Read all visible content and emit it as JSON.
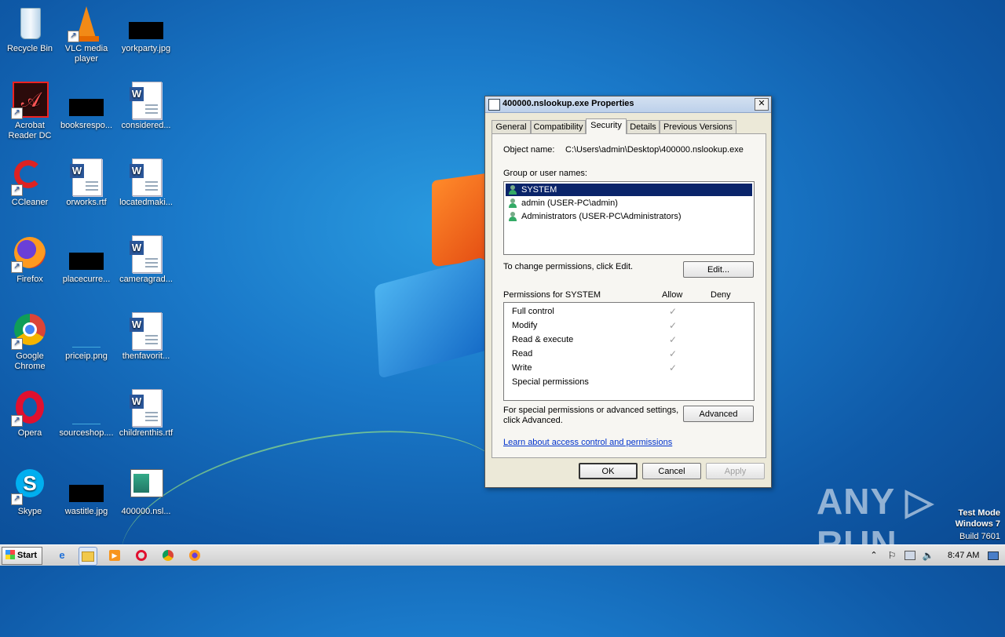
{
  "desktop": {
    "icons": [
      {
        "label": "Recycle Bin",
        "icon": "recycle-bin-icon"
      },
      {
        "label": "VLC media player",
        "icon": "vlc-icon"
      },
      {
        "label": "yorkparty.jpg",
        "icon": "image-file-icon"
      },
      {
        "label": "Acrobat Reader DC",
        "icon": "acrobat-icon"
      },
      {
        "label": "booksrespo...",
        "icon": "image-file-icon"
      },
      {
        "label": "considered...",
        "icon": "word-doc-icon"
      },
      {
        "label": "CCleaner",
        "icon": "ccleaner-icon"
      },
      {
        "label": "orworks.rtf",
        "icon": "word-doc-icon"
      },
      {
        "label": "locatedmaki...",
        "icon": "word-doc-icon"
      },
      {
        "label": "Firefox",
        "icon": "firefox-icon"
      },
      {
        "label": "placecurre...",
        "icon": "image-file-icon"
      },
      {
        "label": "cameragrad...",
        "icon": "word-doc-icon"
      },
      {
        "label": "Google Chrome",
        "icon": "chrome-icon"
      },
      {
        "label": "priceip.png",
        "icon": "image-file-icon"
      },
      {
        "label": "thenfavorit...",
        "icon": "word-doc-icon"
      },
      {
        "label": "Opera",
        "icon": "opera-icon"
      },
      {
        "label": "sourceshop....",
        "icon": "image-file-icon"
      },
      {
        "label": "childrenthis.rtf",
        "icon": "word-doc-icon"
      },
      {
        "label": "Skype",
        "icon": "skype-icon"
      },
      {
        "label": "wastitle.jpg",
        "icon": "image-file-icon"
      },
      {
        "label": "400000.nsl...",
        "icon": "exe-file-icon"
      }
    ]
  },
  "dialog": {
    "title": "400000.nslookup.exe Properties",
    "close": "✕",
    "tabs": [
      "General",
      "Compatibility",
      "Security",
      "Details",
      "Previous Versions"
    ],
    "active_tab": "Security",
    "object_name_label": "Object name:",
    "object_name_value": "C:\\Users\\admin\\Desktop\\400000.nslookup.exe",
    "group_label": "Group or user names:",
    "users": [
      "SYSTEM",
      "admin (USER-PC\\admin)",
      "Administrators (USER-PC\\Administrators)"
    ],
    "selected_user": "SYSTEM",
    "change_text": "To change permissions, click Edit.",
    "edit_button": "Edit...",
    "permissions_label": "Permissions for SYSTEM",
    "allow_header": "Allow",
    "deny_header": "Deny",
    "permissions": [
      {
        "name": "Full control",
        "allow": true,
        "deny": false
      },
      {
        "name": "Modify",
        "allow": true,
        "deny": false
      },
      {
        "name": "Read & execute",
        "allow": true,
        "deny": false
      },
      {
        "name": "Read",
        "allow": true,
        "deny": false
      },
      {
        "name": "Write",
        "allow": true,
        "deny": false
      },
      {
        "name": "Special permissions",
        "allow": false,
        "deny": false
      }
    ],
    "check_glyph": "✓",
    "advanced_text_1": "For special permissions or advanced settings,",
    "advanced_text_2": "click Advanced.",
    "advanced_button": "Advanced",
    "learn_link": "Learn about access control and permissions",
    "ok": "OK",
    "cancel": "Cancel",
    "apply": "Apply"
  },
  "watermark": {
    "brand": "ANY ▷ RUN",
    "line1": "Test Mode",
    "line2": "Windows 7",
    "line3": "Build 7601"
  },
  "taskbar": {
    "start": "Start",
    "pinned": [
      "internet-explorer-icon",
      "file-explorer-icon",
      "media-player-icon",
      "opera-icon",
      "chrome-icon",
      "firefox-icon"
    ],
    "clock": "8:47 AM"
  }
}
